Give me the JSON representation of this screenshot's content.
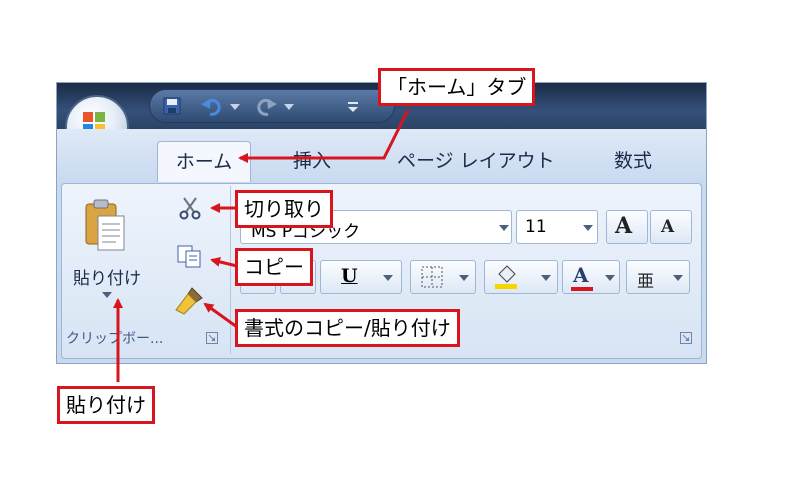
{
  "colors": {
    "accent": "#d8151c",
    "ribbon": "#d7e4f4",
    "titlebar": "#1b2b44"
  },
  "tabs": [
    {
      "id": "home",
      "label": "ホーム"
    },
    {
      "id": "insert",
      "label": "挿入"
    },
    {
      "id": "page-layout",
      "label": "ページ レイアウト"
    },
    {
      "id": "formulas",
      "label": "数式"
    }
  ],
  "clipboard": {
    "paste_label": "貼り付け",
    "group_label": "クリップボー..."
  },
  "font": {
    "name_value": "MS Pゴシック",
    "size_value": "11",
    "grow_label": "A",
    "shrink_label": "A",
    "bold_label": "B",
    "italic_label": "I",
    "underline_label": "U",
    "font_color_label": "A",
    "phonetic_label": "亜"
  },
  "callouts": {
    "home_tab": "「ホーム」タブ",
    "cut": "切り取り",
    "copy": "コピー",
    "format_painter": "書式のコピー/貼り付け",
    "paste": "貼り付け"
  },
  "icons": [
    "office-button-icon",
    "save-icon",
    "undo-icon",
    "redo-icon",
    "qat-dropdown-icon",
    "paste-icon",
    "cut-icon",
    "copy-icon",
    "format-painter-icon",
    "dialog-launcher-icon",
    "border-icon",
    "fill-color-icon"
  ]
}
